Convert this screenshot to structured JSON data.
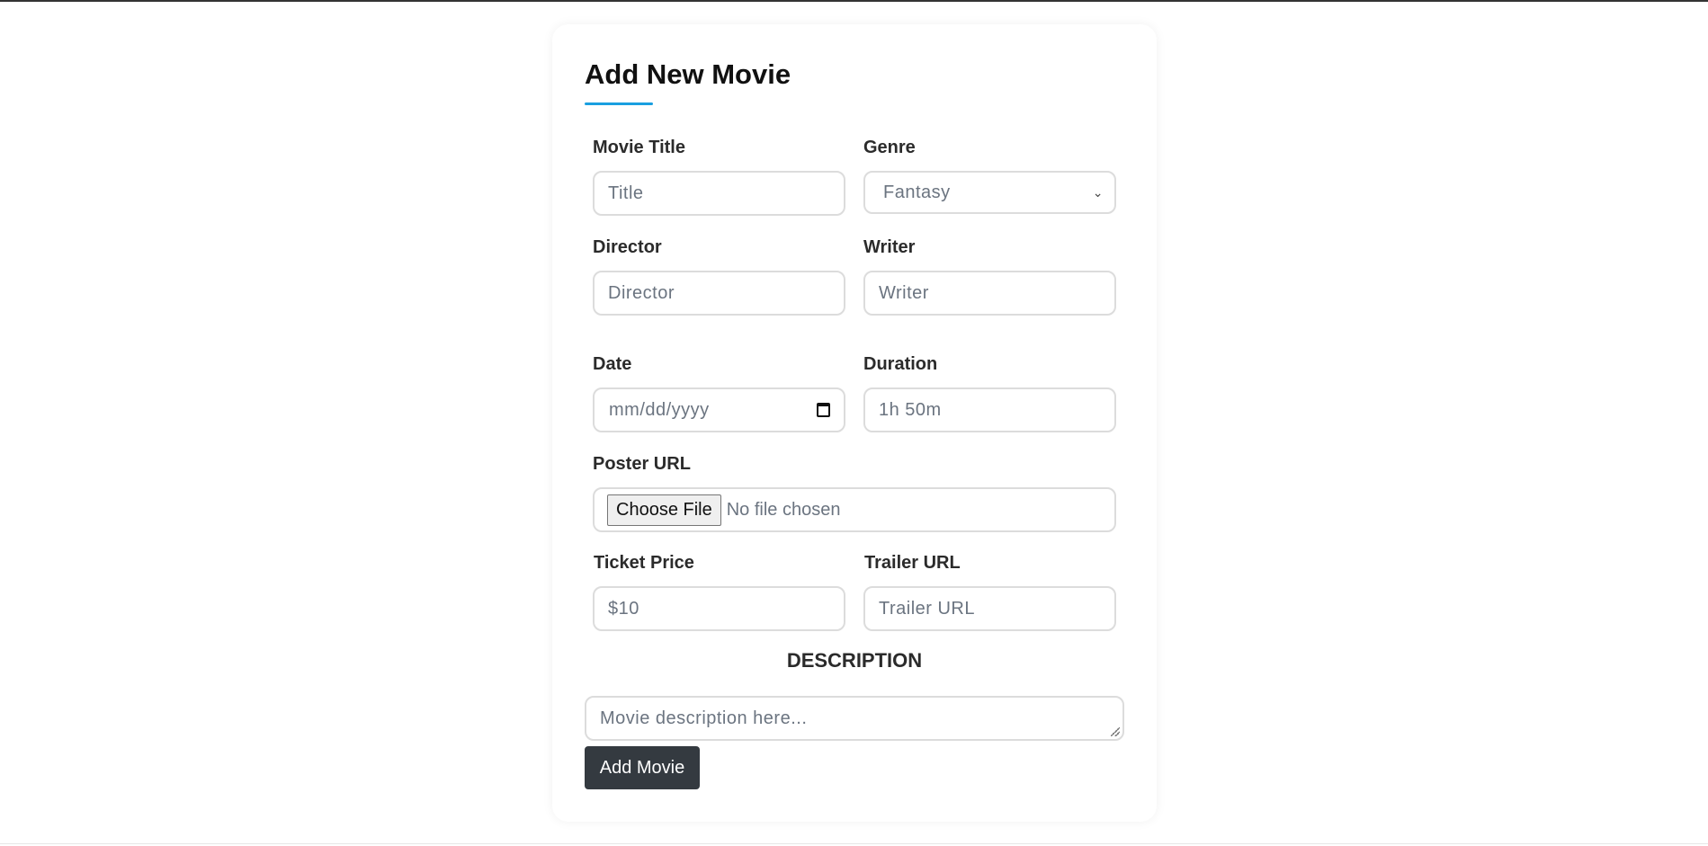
{
  "form": {
    "title": "Add New Movie",
    "accent_color": "#1a9fe0",
    "fields": {
      "movie_title": {
        "label": "Movie Title",
        "placeholder": "Title"
      },
      "genre": {
        "label": "Genre",
        "selected": "Fantasy"
      },
      "director": {
        "label": "Director",
        "placeholder": "Director"
      },
      "writer": {
        "label": "Writer",
        "placeholder": "Writer"
      },
      "date": {
        "label": "Date",
        "placeholder": "mm/dd/yyyy"
      },
      "duration": {
        "label": "Duration",
        "placeholder": "1h 50m"
      },
      "poster_url": {
        "label": "Poster URL",
        "button": "Choose File",
        "status": "No file chosen"
      },
      "ticket_price": {
        "label": "Ticket Price",
        "placeholder": "$10"
      },
      "trailer_url": {
        "label": "Trailer URL",
        "placeholder": "Trailer URL"
      }
    },
    "description": {
      "heading": "DESCRIPTION",
      "placeholder": "Movie description here..."
    },
    "submit_label": "Add Movie",
    "submit_color": "#343a40"
  }
}
